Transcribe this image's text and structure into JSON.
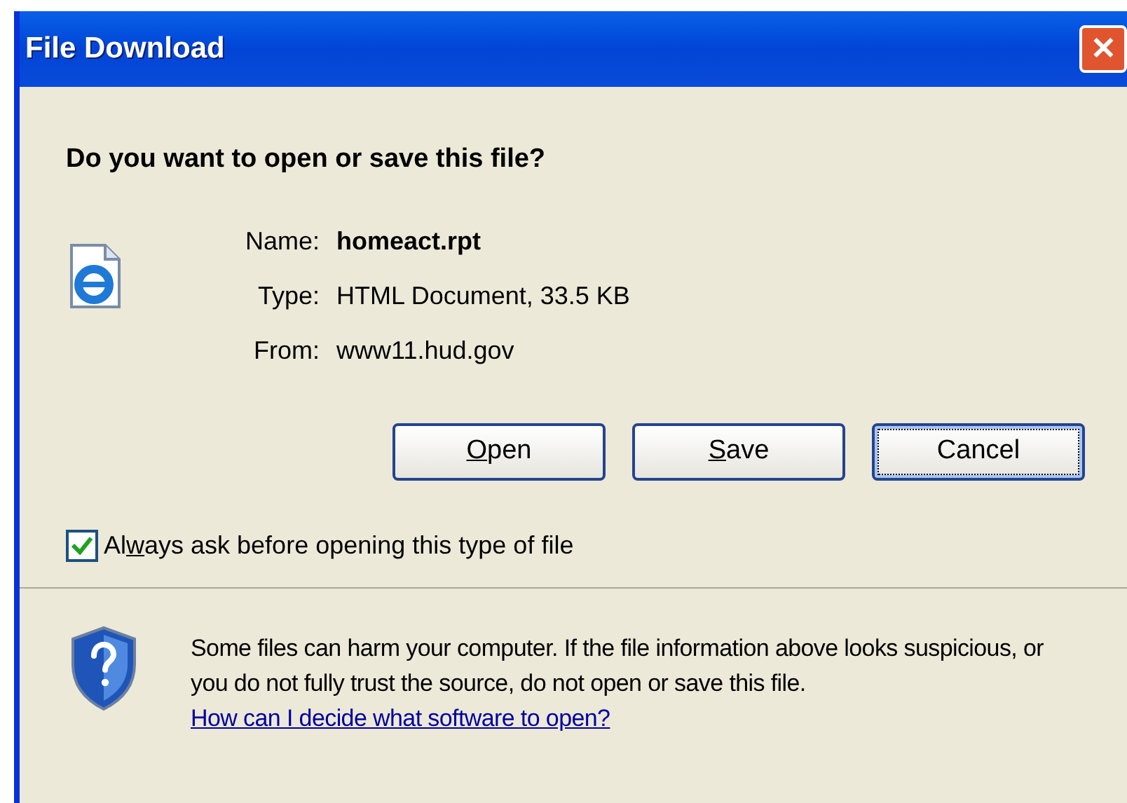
{
  "window": {
    "title": "File Download",
    "close": "✕"
  },
  "question": "Do you want to open or save this file?",
  "file_info": [
    {
      "label": "Name:",
      "value": "homeact.rpt",
      "emphasis": true
    },
    {
      "label": "Type:",
      "value": "HTML Document, 33.5 KB",
      "emphasis": false
    },
    {
      "label": "From:",
      "value": "www11.hud.gov",
      "emphasis": false
    }
  ],
  "buttons": [
    {
      "key": "O",
      "after": "pen",
      "default": false
    },
    {
      "key": "S",
      "after": "ave",
      "default": false
    },
    {
      "before": "Cancel",
      "default": true
    }
  ],
  "always_ask": {
    "before": "Al",
    "key": "w",
    "after": "ays ask before opening this type of file",
    "checked": true
  },
  "warning": {
    "text": "Some files can harm your computer. If the file information above looks suspicious, or you do not fully trust the source, do not open or save this file.",
    "link": "How can I decide what software to open?"
  }
}
